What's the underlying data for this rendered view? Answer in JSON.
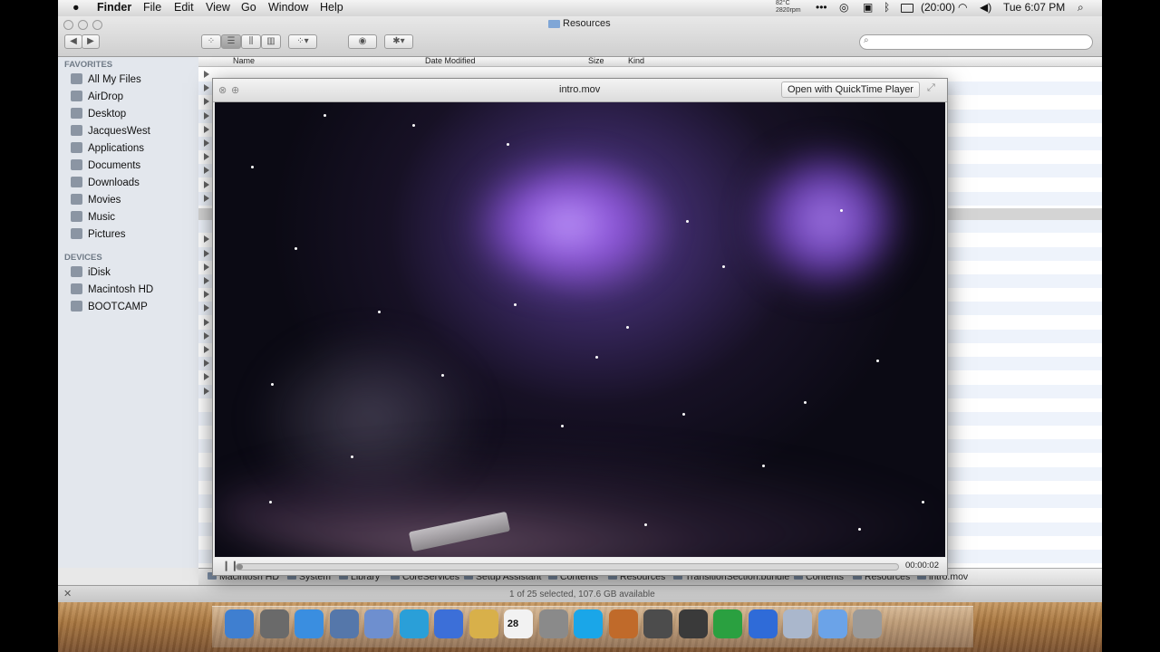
{
  "menubar": {
    "apple_glyph": "",
    "app_name": "Finder",
    "items": [
      "File",
      "Edit",
      "View",
      "Go",
      "Window",
      "Help"
    ],
    "temp": "82°C",
    "rpm": "2820rpm",
    "battery": "(20:00)",
    "clock": "Tue 6:07 PM"
  },
  "finder": {
    "title": "Resources",
    "sidebar": {
      "favorites_header": "FAVORITES",
      "favorites": [
        {
          "label": "All My Files",
          "icon": "all-files-icon"
        },
        {
          "label": "AirDrop",
          "icon": "airdrop-icon"
        },
        {
          "label": "Desktop",
          "icon": "desktop-icon"
        },
        {
          "label": "JacquesWest",
          "icon": "home-icon"
        },
        {
          "label": "Applications",
          "icon": "applications-icon"
        },
        {
          "label": "Documents",
          "icon": "documents-icon"
        },
        {
          "label": "Downloads",
          "icon": "downloads-icon"
        },
        {
          "label": "Movies",
          "icon": "movies-icon"
        },
        {
          "label": "Music",
          "icon": "music-icon"
        },
        {
          "label": "Pictures",
          "icon": "pictures-icon"
        }
      ],
      "devices_header": "DEVICES",
      "devices": [
        {
          "label": "iDisk",
          "icon": "idisk-icon"
        },
        {
          "label": "Macintosh HD",
          "icon": "hard-disk-icon"
        },
        {
          "label": "BOOTCAMP",
          "icon": "hard-disk-icon"
        }
      ]
    },
    "columns": [
      "Name",
      "Date Modified",
      "Size",
      "Kind"
    ],
    "path": [
      "Macintosh HD",
      "System",
      "Library",
      "CoreServices",
      "Setup Assistant",
      "Contents",
      "Resources",
      "TransitionSection.bundle",
      "Contents",
      "Resources",
      "intro.mov"
    ],
    "status": "1 of 25 selected, 107.6 GB available"
  },
  "quicklook": {
    "filename": "intro.mov",
    "open_button": "Open with QuickTime Player",
    "time": "00:00:02",
    "progress": 0.01
  },
  "dock": {
    "calendar_day": "28",
    "items": [
      "finder-icon",
      "launchpad-icon",
      "safari-icon",
      "preview-icon",
      "facetime-icon",
      "twitter-icon",
      "itunes-icon",
      "mail-icon",
      "calendar-icon",
      "system-preferences-icon",
      "skype-icon",
      "iphoto-icon",
      "pineapple-icon",
      "imovie-icon",
      "utorrent-icon",
      "quicktime-icon",
      "applications-folder-icon",
      "downloads-folder-icon",
      "trash-icon"
    ]
  }
}
